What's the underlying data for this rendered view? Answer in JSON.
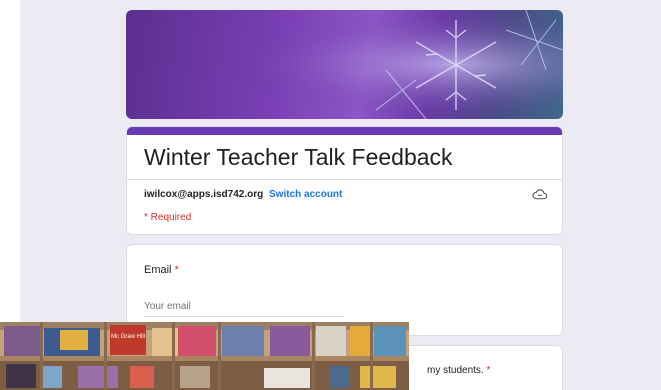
{
  "form": {
    "title": "Winter Teacher Talk Feedback",
    "account_email": "iwilcox@apps.isd742.org",
    "switch_account_label": "Switch account",
    "required_note": "* Required"
  },
  "questions": {
    "email_label": "Email",
    "email_required_mark": "*",
    "email_placeholder": "Your email",
    "q2_label_visible": "my students.",
    "q2_required_mark": "*"
  },
  "photo_overlay": {
    "book_label": "Mc Graw Hill"
  },
  "colors": {
    "page_background": "#ecebf4",
    "accent": "#673ab7",
    "link": "#1a73e8",
    "required": "#d93025"
  },
  "icons": {
    "cloud": "cloud-offline-icon"
  }
}
